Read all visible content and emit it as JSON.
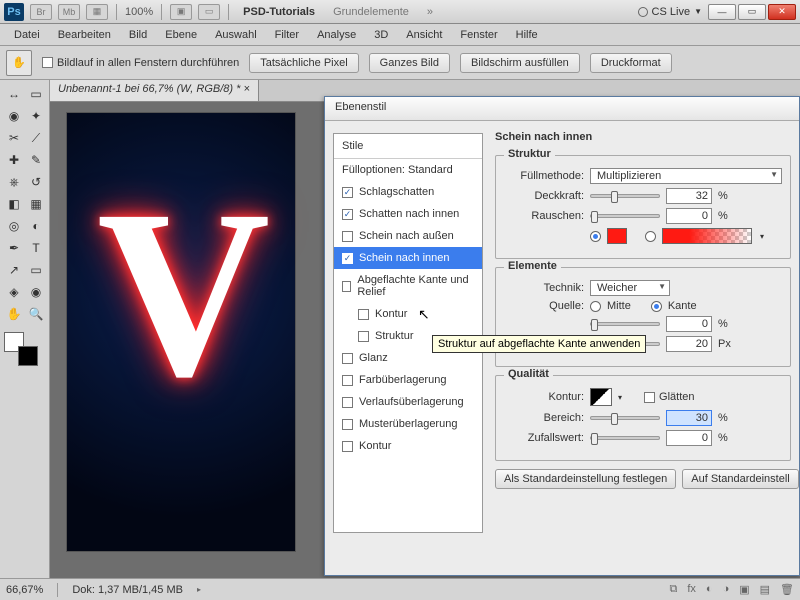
{
  "appbar": {
    "logo": "Ps",
    "mini1": "Br",
    "mini2": "Mb",
    "zoom": "100%",
    "crumb_active": "PSD-Tutorials",
    "crumb2": "Grundelemente",
    "chev": "»",
    "cs_live": "CS Live"
  },
  "menu": [
    "Datei",
    "Bearbeiten",
    "Bild",
    "Ebene",
    "Auswahl",
    "Filter",
    "Analyse",
    "3D",
    "Ansicht",
    "Fenster",
    "Hilfe"
  ],
  "optbar": {
    "scroll_all": "Bildlauf in allen Fenstern durchführen",
    "b1": "Tatsächliche Pixel",
    "b2": "Ganzes Bild",
    "b3": "Bildschirm ausfüllen",
    "b4": "Druckformat"
  },
  "doc_tab": "Unbenannt-1 bei 66,7% (W, RGB/8) *",
  "dialog": {
    "title": "Ebenenstil",
    "styles_header": "Stile",
    "fill_opts": "Fülloptionen: Standard",
    "items": [
      {
        "label": "Schlagschatten",
        "checked": true
      },
      {
        "label": "Schatten nach innen",
        "checked": true
      },
      {
        "label": "Schein nach außen",
        "checked": false
      },
      {
        "label": "Schein nach innen",
        "checked": true,
        "selected": true
      },
      {
        "label": "Abgeflachte Kante und Relief",
        "checked": false
      },
      {
        "label": "Kontur",
        "checked": false,
        "indent": true
      },
      {
        "label": "Struktur",
        "checked": false,
        "indent": true
      },
      {
        "label": "Glanz",
        "checked": false
      },
      {
        "label": "Farbüberlagerung",
        "checked": false
      },
      {
        "label": "Verlaufsüberlagerung",
        "checked": false
      },
      {
        "label": "Musterüberlagerung",
        "checked": false
      },
      {
        "label": "Kontur",
        "checked": false
      }
    ],
    "panel_title": "Schein nach innen",
    "struktur": {
      "legend": "Struktur",
      "fill_label": "Füllmethode:",
      "fill_value": "Multiplizieren",
      "opacity_label": "Deckkraft:",
      "opacity_value": "32",
      "noise_label": "Rauschen:",
      "noise_value": "0",
      "pct": "%"
    },
    "elemente": {
      "legend": "Elemente",
      "technik_label": "Technik:",
      "technik_value": "Weicher",
      "quelle_label": "Quelle:",
      "mitte": "Mitte",
      "kante": "Kante",
      "ueber_value": "0",
      "groesse_label": "Größe:",
      "groesse_value": "20",
      "px": "Px",
      "pct": "%"
    },
    "qualitaet": {
      "legend": "Qualität",
      "kontur_label": "Kontur:",
      "glaetten": "Glätten",
      "bereich_label": "Bereich:",
      "bereich_value": "30",
      "zufall_label": "Zufallswert:",
      "zufall_value": "0",
      "pct": "%"
    },
    "btn_default": "Als Standardeinstellung festlegen",
    "btn_reset": "Auf Standardeinstell"
  },
  "tooltip": "Struktur auf abgeflachte Kante anwenden",
  "status": {
    "zoom": "66,67%",
    "dok": "Dok: 1,37 MB/1,45 MB"
  }
}
